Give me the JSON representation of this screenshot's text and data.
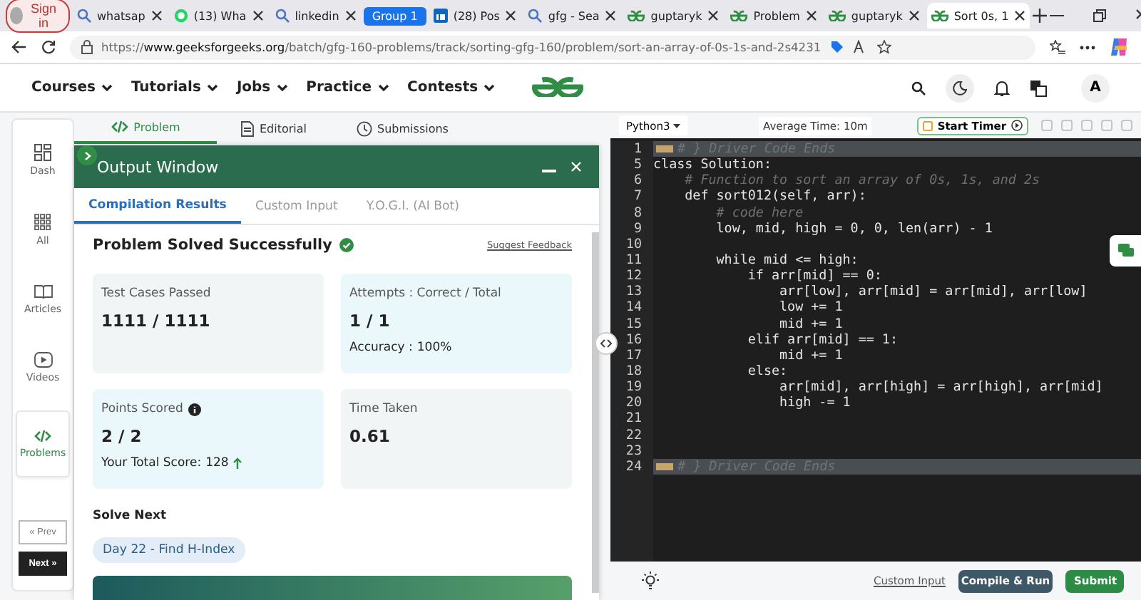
{
  "browser": {
    "sign_in": "Sign in",
    "tabs": [
      {
        "kind": "tab",
        "title": "whatsap",
        "selected": false
      },
      {
        "kind": "tab",
        "title": "(13) Wha",
        "selected": false
      },
      {
        "kind": "tab",
        "title": "linkedin",
        "selected": false
      },
      {
        "kind": "group",
        "title": "Group 1"
      },
      {
        "kind": "tab",
        "title": "(28) Pos",
        "selected": false
      },
      {
        "kind": "tab",
        "title": "gfg - Sea",
        "selected": false
      },
      {
        "kind": "tab",
        "title": "guptaryk",
        "selected": false
      },
      {
        "kind": "tab",
        "title": "Problem",
        "selected": false
      },
      {
        "kind": "tab",
        "title": "guptaryk",
        "selected": false
      },
      {
        "kind": "tab",
        "title": "Sort 0s, 1",
        "selected": true
      }
    ],
    "url": "https://**www.geeksforgeeks.org**/batch/gfg-160-problems/track/sorting-gfg-160/problem/sort-an-array-of-0s-1s-and-2s4231"
  },
  "nav": {
    "items": [
      "Courses",
      "Tutorials",
      "Jobs",
      "Practice",
      "Contests"
    ],
    "avatar": "A"
  },
  "rail": {
    "items": [
      {
        "label": "Dash",
        "selected": false
      },
      {
        "label": "All",
        "selected": false
      },
      {
        "label": "Articles",
        "selected": false
      },
      {
        "label": "Videos",
        "selected": false
      },
      {
        "label": "Problems",
        "selected": true
      }
    ],
    "prev": "« Prev",
    "next": "Next »"
  },
  "problem_tabs": [
    {
      "label": "Problem",
      "selected": true
    },
    {
      "label": "Editorial",
      "selected": false
    },
    {
      "label": "Submissions",
      "selected": false
    }
  ],
  "output": {
    "title": "Output Window",
    "tabs": [
      {
        "label": "Compilation Results",
        "selected": true
      },
      {
        "label": "Custom Input",
        "selected": false
      },
      {
        "label": "Y.O.G.I. (AI Bot)",
        "selected": false
      }
    ],
    "status": "Problem Solved Successfully",
    "feedback": "Suggest Feedback",
    "cards": [
      {
        "label": "Test Cases Passed",
        "value": "1111 / 1111",
        "color": "#f1f5f5",
        "info": false
      },
      {
        "label": "Attempts : Correct / Total",
        "value": "1 / 1",
        "note_label": "Accuracy : ",
        "note_value": "100%",
        "color": "#eaf8fc",
        "info": false
      },
      {
        "label": "Points Scored",
        "value": "2 / 2",
        "note_label": "Your Total Score: ",
        "note_value": "128",
        "color": "#eaf8fc",
        "info": true
      },
      {
        "label": "Time Taken",
        "value": "0.61",
        "color": "#f1f5f5",
        "info": false
      }
    ],
    "solve_next": {
      "heading": "Solve Next",
      "chip": "Day 22 - Find H-Index"
    }
  },
  "editor": {
    "language": "Python3",
    "average_time": "Average Time: 10m",
    "timer": "Start Timer",
    "lines": [
      {
        "num": "1",
        "kind": "fold",
        "text": "# } Driver Code Ends"
      },
      {
        "num": "5",
        "kind": "code",
        "text": "class Solution:"
      },
      {
        "num": "6",
        "kind": "comment",
        "text": "    # Function to sort an array of 0s, 1s, and 2s"
      },
      {
        "num": "7",
        "kind": "code",
        "text": "    def sort012(self, arr):"
      },
      {
        "num": "8",
        "kind": "comment",
        "text": "        # code here"
      },
      {
        "num": "9",
        "kind": "code",
        "text": "        low, mid, high = 0, 0, len(arr) - 1"
      },
      {
        "num": "10",
        "kind": "code"
      },
      {
        "num": "11",
        "kind": "code",
        "text": "        while mid <= high:"
      },
      {
        "num": "12",
        "kind": "code",
        "text": "            if arr[mid] == 0:"
      },
      {
        "num": "13",
        "kind": "code",
        "text": "                arr[low], arr[mid] = arr[mid], arr[low]"
      },
      {
        "num": "14",
        "kind": "code",
        "text": "                low += 1"
      },
      {
        "num": "15",
        "kind": "code",
        "text": "                mid += 1"
      },
      {
        "num": "16",
        "kind": "code",
        "text": "            elif arr[mid] == 1:"
      },
      {
        "num": "17",
        "kind": "code",
        "text": "                mid += 1"
      },
      {
        "num": "18",
        "kind": "code",
        "text": "            else:"
      },
      {
        "num": "19",
        "kind": "code",
        "text": "                arr[mid], arr[high] = arr[high], arr[mid]"
      },
      {
        "num": "20",
        "kind": "code",
        "text": "                high -= 1"
      },
      {
        "num": "21",
        "kind": "code"
      },
      {
        "num": "22",
        "kind": "code"
      },
      {
        "num": "23",
        "kind": "code"
      },
      {
        "num": "24",
        "kind": "fold",
        "text": "# } Driver Code Ends"
      }
    ],
    "custom_input": "Custom Input",
    "compile": "Compile & Run",
    "submit": "Submit"
  }
}
